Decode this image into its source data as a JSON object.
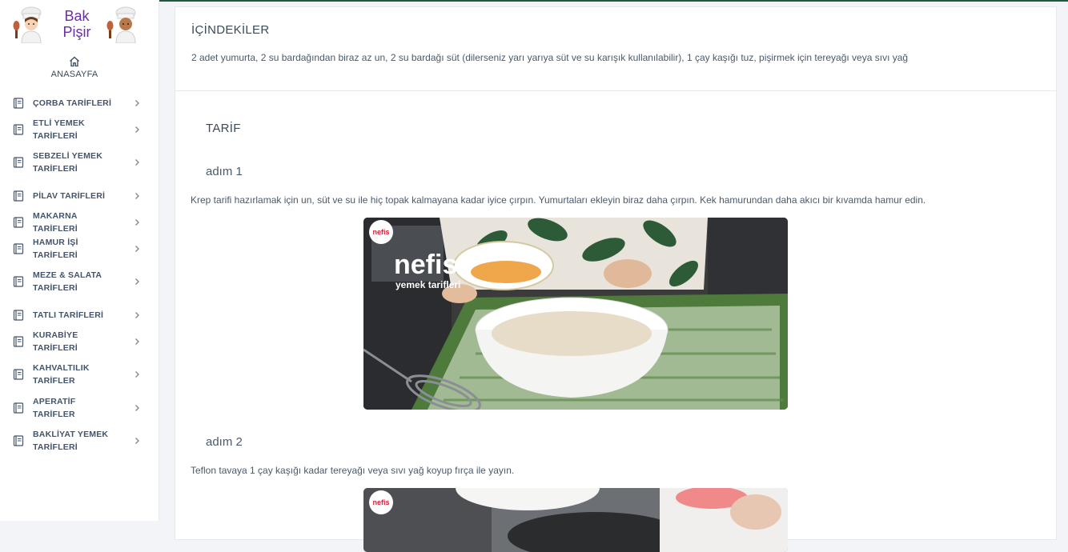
{
  "logo": {
    "text_line1": "Bak",
    "text_line2": "Pişir"
  },
  "nav": {
    "home_label": "ANASAYFA",
    "items": [
      {
        "label": "ÇORBA TARİFLERİ"
      },
      {
        "label": "ETLİ YEMEK TARİFLERİ"
      },
      {
        "label": "SEBZELİ YEMEK TARİFLERİ"
      },
      {
        "label": "PİLAV TARİFLERİ"
      },
      {
        "label": "MAKARNA TARİFLERİ"
      },
      {
        "label": "HAMUR İŞİ TARİFLERİ"
      },
      {
        "label": "MEZE & SALATA TARİFLERİ"
      },
      {
        "label": "TATLI TARİFLERİ"
      },
      {
        "label": "KURABİYE TARİFLERİ"
      },
      {
        "label": "KAHVALTILIK TARİFLER"
      },
      {
        "label": "APERATİF TARİFLER"
      },
      {
        "label": "BAKLİYAT YEMEK TARİFLERİ"
      }
    ]
  },
  "ingredients": {
    "title": "İÇİNDEKİLER",
    "text": "2 adet yumurta, 2 su bardağından biraz az un, 2 su bardağı süt (dilerseniz yarı yarıya süt ve su karışık kullanılabilir), 1 çay kaşığı tuz, pişirmek için tereyağı veya sıvı yağ"
  },
  "recipe": {
    "title": "TARİF",
    "steps": [
      {
        "title": "adım 1",
        "text": "Krep tarifi hazırlamak için un, süt ve su ile hiç topak kalmayana kadar iyice çırpın. Yumurtaları ekleyin biraz daha çırpın. Kek hamurundan daha akıcı bir kıvamda hamur edin.",
        "image_watermark_badge": "nefis",
        "image_watermark_line1": "nefis",
        "image_watermark_line2": "yemek tarifleri"
      },
      {
        "title": "adım 2",
        "text": "Teflon tavaya 1 çay kaşığı kadar tereyağı veya sıvı yağ koyup fırça ile yayın.",
        "image_watermark_badge": "nefis"
      }
    ]
  },
  "colors": {
    "brand_purple": "#6a2fa3",
    "top_bar": "#1f5a3a",
    "nav_text": "#44546a"
  }
}
